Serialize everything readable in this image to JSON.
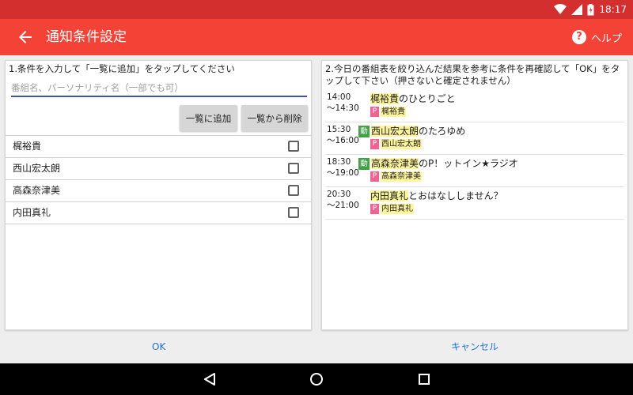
{
  "status_bar": {
    "time": "18:17"
  },
  "toolbar": {
    "title": "通知条件設定",
    "help_label": "ヘルプ"
  },
  "left_panel": {
    "instruction": "1.条件を入力して「一覧に追加」をタップしてください",
    "search_placeholder": "番組名、パーソナリティ名（一部でも可）",
    "add_button": "一覧に追加",
    "remove_button": "一覧から削除",
    "items": [
      {
        "name": "梶裕貴",
        "checked": false
      },
      {
        "name": "西山宏太朗",
        "checked": false
      },
      {
        "name": "高森奈津美",
        "checked": false
      },
      {
        "name": "内田真礼",
        "checked": false
      }
    ]
  },
  "right_panel": {
    "instruction": "2.今日の番組表を絞り込んだ結果を参考に条件を再確認して「OK」をタップして下さい（押さないと確定されません）",
    "programs": [
      {
        "start": "14:00",
        "end": "〜14:30",
        "badge": "",
        "title_highlight": "梶裕貴",
        "title_rest": "のひとりごと",
        "p_mark": "P",
        "personality": "梶裕貴"
      },
      {
        "start": "15:30",
        "end": "〜16:00",
        "badge": "動",
        "title_highlight": "西山宏太朗",
        "title_rest": "のたろゆめ",
        "p_mark": "P",
        "personality": "西山宏太朗"
      },
      {
        "start": "18:30",
        "end": "〜19:00",
        "badge": "動",
        "title_highlight": "高森奈津美",
        "title_rest": "のP！ットイン★ラジオ",
        "p_mark": "P",
        "personality": "高森奈津美"
      },
      {
        "start": "20:30",
        "end": "〜21:00",
        "badge": "",
        "title_highlight": "内田真礼",
        "title_rest": "とおはなししません？",
        "p_mark": "P",
        "personality": "内田真礼"
      }
    ]
  },
  "actions": {
    "ok": "OK",
    "cancel": "キャンセル"
  },
  "colors": {
    "status_bar": "#d32f2f",
    "toolbar": "#f44336",
    "accent": "#3f51b5",
    "action_text": "#1e6fd9",
    "highlight": "#fff59d",
    "badge_green": "#43a047",
    "p_pink": "#f06292"
  },
  "icons": {
    "wifi": "wifi-icon",
    "signal": "signal-icon",
    "battery": "battery-icon",
    "back": "arrow-back-icon",
    "help": "help-icon",
    "nav_back": "nav-back-icon",
    "nav_home": "nav-home-icon",
    "nav_recent": "nav-recent-icon"
  }
}
